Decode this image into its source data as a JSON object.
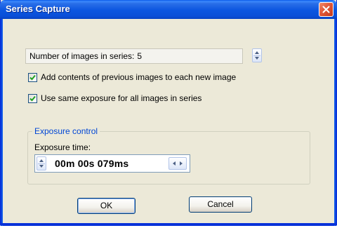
{
  "window": {
    "title": "Series Capture"
  },
  "series": {
    "images_label": "Number of images in series:",
    "images_value": "5"
  },
  "options": {
    "add_contents_label": "Add contents of previous images to each new image",
    "add_contents_checked": true,
    "same_exposure_label": "Use same exposure for all images in series",
    "same_exposure_checked": true
  },
  "exposure": {
    "group_title": "Exposure control",
    "time_label": "Exposure time:",
    "time_value": "00m 00s 079ms"
  },
  "buttons": {
    "ok_label": "OK",
    "cancel_label": "Cancel"
  },
  "icons": {
    "close": "close-icon",
    "spin_updown": "spin-up-down-icon",
    "spin_leftright": "spin-left-right-icon",
    "checkmark": "checkmark-icon"
  },
  "colors": {
    "titlebar": "#0a55e0",
    "close_button": "#e2583a",
    "dialog_background": "#ece9d8",
    "group_title": "#0046d5",
    "checkmark": "#21a121"
  }
}
